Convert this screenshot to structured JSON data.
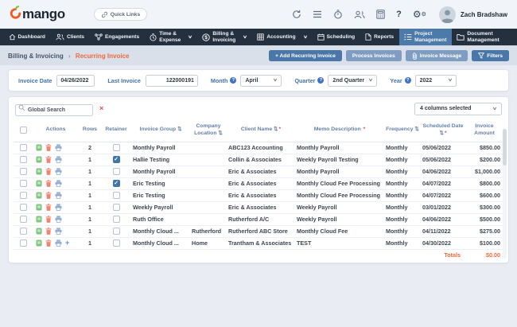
{
  "brand": {
    "logo_text": "mango",
    "quick_links_label": "Quick Links"
  },
  "user": {
    "name": "Zach Bradshaw"
  },
  "header_icons": [
    "sync-icon",
    "menu-icon",
    "timer-icon",
    "users-icon",
    "calculator-icon",
    "help-icon",
    "settings-icon"
  ],
  "nav": {
    "items": [
      {
        "line1": "Dashboard",
        "icon": "home-icon"
      },
      {
        "line1": "Clients",
        "icon": "clients-icon"
      },
      {
        "line1": "Engagements",
        "icon": "engagements-icon"
      },
      {
        "line1": "Time &",
        "line2": "Expense",
        "icon": "clock-icon",
        "chevron": "∨"
      },
      {
        "line1": "Billing &",
        "line2": "Invoicing",
        "icon": "billing-icon",
        "chevron": "∨"
      },
      {
        "line1": "Accounting",
        "icon": "accounting-icon",
        "chevron": "∨"
      },
      {
        "line1": "Scheduling",
        "icon": "calendar-icon"
      },
      {
        "line1": "Reports",
        "icon": "report-icon"
      },
      {
        "line1": "Project",
        "line2": "Management",
        "icon": "tasks-icon",
        "selected": true
      },
      {
        "line1": "Document",
        "line2": "Management",
        "icon": "folder-icon"
      }
    ]
  },
  "breadcrumb": {
    "parent": "Billing & Invoicing",
    "separator": "›",
    "current": "Recurring Invoice"
  },
  "toolbar": {
    "add_label": "+ Add Recurring Invoice",
    "process_label": "Process Invoices",
    "message_label": "Invoice Message",
    "filters_label": "Filters"
  },
  "filters": {
    "invoice_date": {
      "label": "Invoice Date",
      "value": "04/26/2022"
    },
    "last_invoice": {
      "label": "Last Invoice",
      "value": "122000191"
    },
    "month": {
      "label": "Month",
      "value": "April"
    },
    "quarter": {
      "label": "Quarter",
      "value": "2nd Quarter"
    },
    "year": {
      "label": "Year",
      "value": "2022"
    },
    "help_glyph": "?"
  },
  "search": {
    "placeholder": "Global Search",
    "clear_glyph": "×"
  },
  "columns_selector": {
    "value": "4 columns selected"
  },
  "table": {
    "headers": [
      {
        "label": ""
      },
      {
        "label": "Actions"
      },
      {
        "label": "Rows"
      },
      {
        "label": "Retainer"
      },
      {
        "label": "Invoice Group",
        "sortable": true
      },
      {
        "label": "Company Location",
        "sortable": true
      },
      {
        "label": "Client Name",
        "sortable": true,
        "required": true
      },
      {
        "label": "Memo Description",
        "required": true
      },
      {
        "label": "Frequency",
        "sortable": true
      },
      {
        "label": "Scheduled Date",
        "sortable": true,
        "required": true
      },
      {
        "label": "Invoice Amount"
      }
    ],
    "sort_glyph": "⇅",
    "required_glyph": "*",
    "row_action_icons": [
      "invoice-icon",
      "delete-icon",
      "print-icon"
    ],
    "rows": [
      {
        "rows": "2",
        "retainer": false,
        "invoice_group": "Monthly Payroll",
        "company_location": "",
        "client_name": "ABC123 Accounting",
        "memo": "Monthly Payroll",
        "frequency": "Monthly",
        "scheduled_date": "05/06/2022",
        "amount": "$850.00",
        "has_add": false
      },
      {
        "rows": "1",
        "retainer": true,
        "invoice_group": "Hallie Testing",
        "company_location": "",
        "client_name": "Collin & Associates",
        "memo": "Weekly Payroll Testing",
        "frequency": "Monthly",
        "scheduled_date": "05/06/2022",
        "amount": "$200.00",
        "has_add": false
      },
      {
        "rows": "1",
        "retainer": false,
        "invoice_group": "Monthly Payroll",
        "company_location": "",
        "client_name": "Eric & Associates",
        "memo": "Monthly Payroll",
        "frequency": "Monthly",
        "scheduled_date": "04/06/2022",
        "amount": "$1,000.00",
        "has_add": false
      },
      {
        "rows": "1",
        "retainer": true,
        "invoice_group": "Eric Testing",
        "company_location": "",
        "client_name": "Eric & Associates",
        "memo": "Monthly Cloud Fee Processing",
        "frequency": "Monthly",
        "scheduled_date": "04/07/2022",
        "amount": "$800.00",
        "has_add": false
      },
      {
        "rows": "1",
        "retainer": false,
        "invoice_group": "Eric Testing",
        "company_location": "",
        "client_name": "Eric & Associates",
        "memo": "Monthly Cloud Fee Processing",
        "frequency": "Monthly",
        "scheduled_date": "04/07/2022",
        "amount": "$600.00",
        "has_add": false
      },
      {
        "rows": "1",
        "retainer": false,
        "invoice_group": "Weekly Payroll",
        "company_location": "",
        "client_name": "Eric & Associates",
        "memo": "Weekly Payroll",
        "frequency": "Monthly",
        "scheduled_date": "03/01/2022",
        "amount": "$300.00",
        "has_add": false
      },
      {
        "rows": "1",
        "retainer": false,
        "invoice_group": "Ruth Office",
        "company_location": "",
        "client_name": "Rutherford A/C",
        "memo": "Weekly Payroll",
        "frequency": "Monthly",
        "scheduled_date": "04/06/2022",
        "amount": "$500.00",
        "has_add": false
      },
      {
        "rows": "1",
        "retainer": false,
        "invoice_group": "Monthly Cloud ...",
        "company_location": "Rutherford",
        "client_name": "Rutherford ABC Store",
        "memo": "Monthly Cloud Fee",
        "frequency": "Monthly",
        "scheduled_date": "04/11/2022",
        "amount": "$275.00",
        "has_add": false
      },
      {
        "rows": "1",
        "retainer": false,
        "invoice_group": "Monthly Cloud ...",
        "company_location": "Home",
        "client_name": "Trantham & Associates",
        "memo": "TEST",
        "frequency": "Monthly",
        "scheduled_date": "04/30/2022",
        "amount": "$100.00",
        "has_add": true
      }
    ],
    "totals": {
      "label": "Totals",
      "value": "$0.00"
    }
  },
  "colors": {
    "accent_orange": "#f2673a",
    "primary_blue": "#4a77a9",
    "muted_button_blue": "#7f9dc3",
    "nav_dark": "#25303f",
    "nav_selected": "#4d7ba9",
    "label_blue": "#4273a9",
    "header_text_blue": "#6381a6",
    "success_green": "#7cc67e",
    "delete_red": "#ee8472",
    "print_steel": "#93aed0",
    "required_red": "#e34f4f"
  }
}
